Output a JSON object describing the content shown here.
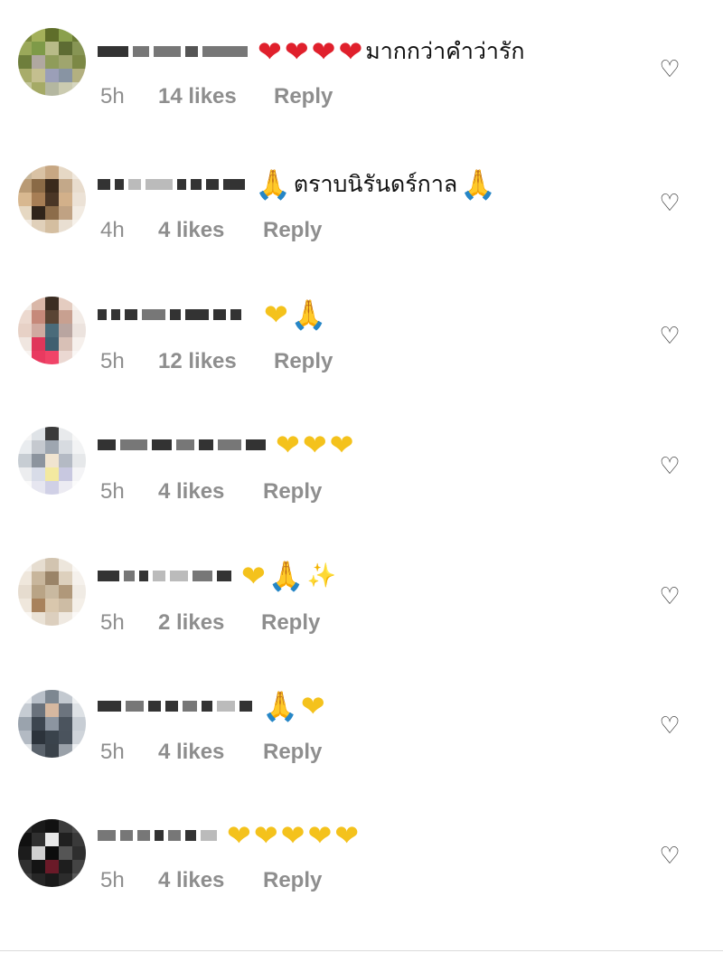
{
  "comments": [
    {
      "text": "มากกว่าคำว่ารัก",
      "emoji_before": [
        "red-heart",
        "red-heart",
        "red-heart",
        "red-heart"
      ],
      "emoji_after": [],
      "time": "5h",
      "likes": "14 likes",
      "reply": "Reply"
    },
    {
      "text": "ตราบนิรันดร์กาล",
      "emoji_before": [
        "folded-hands"
      ],
      "emoji_after": [
        "folded-hands"
      ],
      "time": "4h",
      "likes": "4 likes",
      "reply": "Reply"
    },
    {
      "text": "",
      "emoji_before": [
        "yellow-heart",
        "folded-hands"
      ],
      "emoji_after": [],
      "time": "5h",
      "likes": "12 likes",
      "reply": "Reply"
    },
    {
      "text": "",
      "emoji_before": [
        "yellow-heart",
        "yellow-heart",
        "yellow-heart"
      ],
      "emoji_after": [],
      "time": "5h",
      "likes": "4 likes",
      "reply": "Reply"
    },
    {
      "text": "",
      "emoji_before": [
        "yellow-heart",
        "folded-hands",
        "sparkles"
      ],
      "emoji_after": [],
      "time": "5h",
      "likes": "2 likes",
      "reply": "Reply"
    },
    {
      "text": "",
      "emoji_before": [
        "folded-hands",
        "yellow-heart"
      ],
      "emoji_after": [],
      "time": "5h",
      "likes": "4 likes",
      "reply": "Reply"
    },
    {
      "text": "",
      "emoji_before": [
        "yellow-heart",
        "yellow-heart",
        "yellow-heart",
        "yellow-heart",
        "yellow-heart"
      ],
      "emoji_after": [],
      "time": "5h",
      "likes": "4 likes",
      "reply": "Reply"
    }
  ],
  "icons": {
    "like": "heart-outline-icon"
  },
  "colors": {
    "meta_text": "#8e8e8e",
    "red_heart": "#e0202c",
    "yellow_heart": "#f4c21c"
  }
}
